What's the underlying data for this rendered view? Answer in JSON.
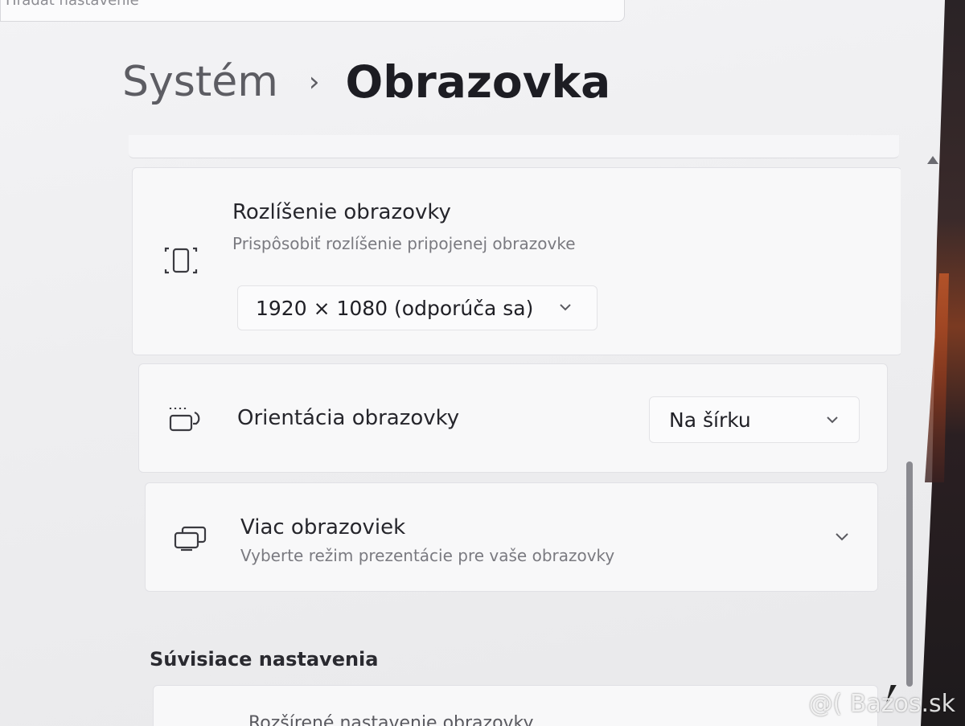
{
  "search": {
    "placeholder": "Hľadať nastavenie"
  },
  "breadcrumb": {
    "parent": "Systém",
    "separator": "›",
    "current": "Obrazovka"
  },
  "settings": {
    "resolution": {
      "title": "Rozlíšenie obrazovky",
      "subtitle": "Prispôsobiť rozlíšenie pripojenej obrazovke",
      "value": "1920 × 1080 (odporúča sa)",
      "icon": "resolution-icon"
    },
    "orientation": {
      "title": "Orientácia obrazovky",
      "value": "Na šírku",
      "icon": "orientation-icon"
    },
    "multiple_displays": {
      "title": "Viac obrazoviek",
      "subtitle": "Vyberte režim prezentácie pre vaše obrazovky",
      "icon": "multiple-displays-icon"
    }
  },
  "related": {
    "heading": "Súvisiace nastavenia",
    "advanced_display": "Rozšírené nastavenie obrazovky"
  },
  "watermark": "@( Bazos.sk"
}
